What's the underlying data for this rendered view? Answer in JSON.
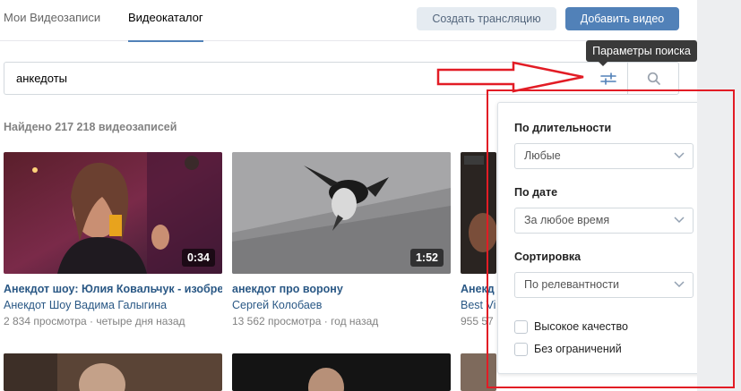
{
  "tabs": [
    {
      "label": "Мои Видеозаписи"
    },
    {
      "label": "Видеокаталог"
    }
  ],
  "header": {
    "create_stream_label": "Создать трансляцию",
    "add_video_label": "Добавить видео"
  },
  "search": {
    "value": "анкедоты",
    "tooltip": "Параметры поиска"
  },
  "results": {
    "found_text": "Найдено 217 218 видеозаписей"
  },
  "videos": [
    {
      "title": "Анекдот шоу: Юлия Ковальчук - изобре",
      "author": "Анекдот Шоу Вадима Галыгина",
      "views": "2 834 просмотра",
      "sep": " · ",
      "date": "четыре дня назад",
      "duration": "0:34"
    },
    {
      "title": "анекдот про ворону",
      "author": "Сергей Колобаев",
      "views": "13 562 просмотра",
      "sep": " · ",
      "date": "год назад",
      "duration": "1:52"
    },
    {
      "title": "Анекд",
      "author": "Best Vi",
      "views": "955 57",
      "sep": "",
      "date": "",
      "duration": ""
    }
  ],
  "filters": {
    "duration_label": "По длительности",
    "duration_value": "Любые",
    "date_label": "По дате",
    "date_value": "За любое время",
    "sort_label": "Сортировка",
    "sort_value": "По релевантности",
    "hq_label": "Высокое качество",
    "unrestricted_label": "Без ограничений",
    "hq_checked": false,
    "unrestricted_checked": false
  },
  "colors": {
    "accent": "#5181b8",
    "link": "#2a5885",
    "annotation": "#e21c25"
  },
  "icons": [
    "filter-sliders-icon",
    "search-icon",
    "chevron-down-icon",
    "red-arrow-annotation"
  ]
}
